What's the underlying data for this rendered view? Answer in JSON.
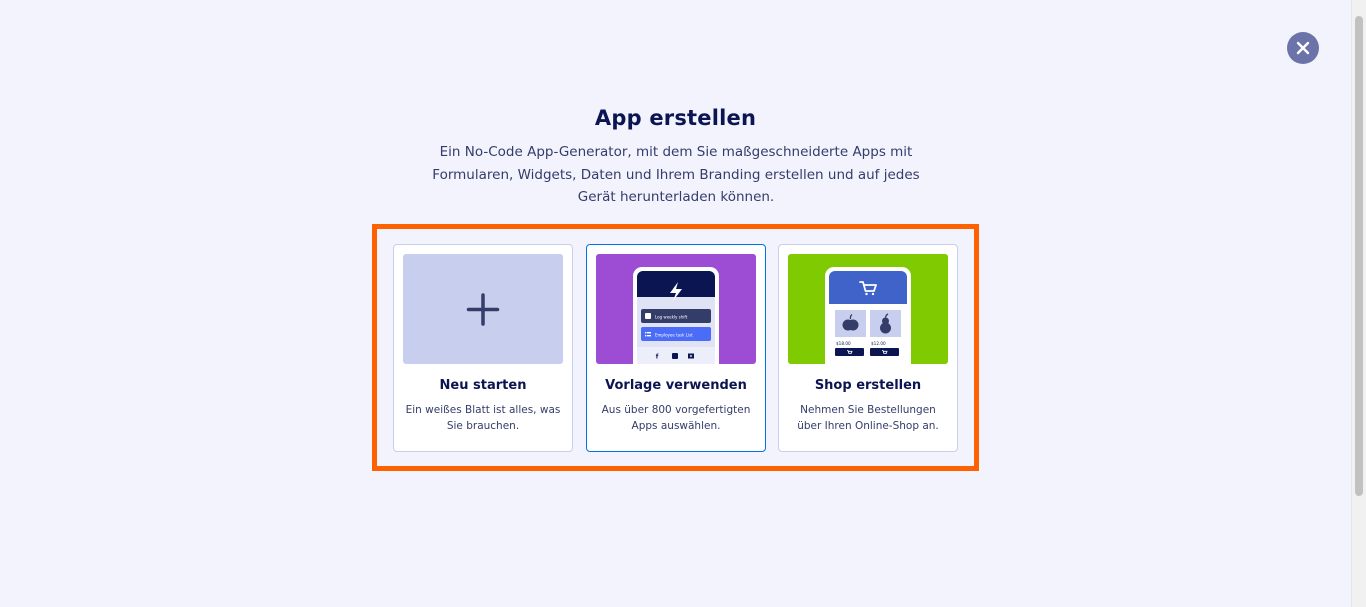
{
  "header": {
    "title": "App erstellen",
    "subtitle": "Ein No-Code App-Generator, mit dem Sie maßgeschneiderte Apps mit Formularen, Widgets, Daten und Ihrem Branding erstellen und auf jedes Gerät herunterladen können."
  },
  "close_icon": "close-icon",
  "options": [
    {
      "title": "Neu starten",
      "description": "Ein weißes Blatt ist alles, was Sie brauchen.",
      "icon": "plus-icon"
    },
    {
      "title": "Vorlage verwenden",
      "description": "Aus über 800 vorgefertigten Apps auswählen.",
      "preview_items": [
        "Log weekly shift",
        "Employee task List"
      ]
    },
    {
      "title": "Shop erstellen",
      "description": "Nehmen Sie Bestellungen über Ihren Online-Shop an.",
      "prices": [
        "$18.00",
        "$12.00"
      ]
    }
  ],
  "colors": {
    "background": "#f3f3fe",
    "highlight": "#ff6100",
    "close_button": "#6c73a8",
    "thumb_start": "#c8ceed",
    "thumb_template": "#9c4dd3",
    "thumb_shop": "#7fca00"
  }
}
